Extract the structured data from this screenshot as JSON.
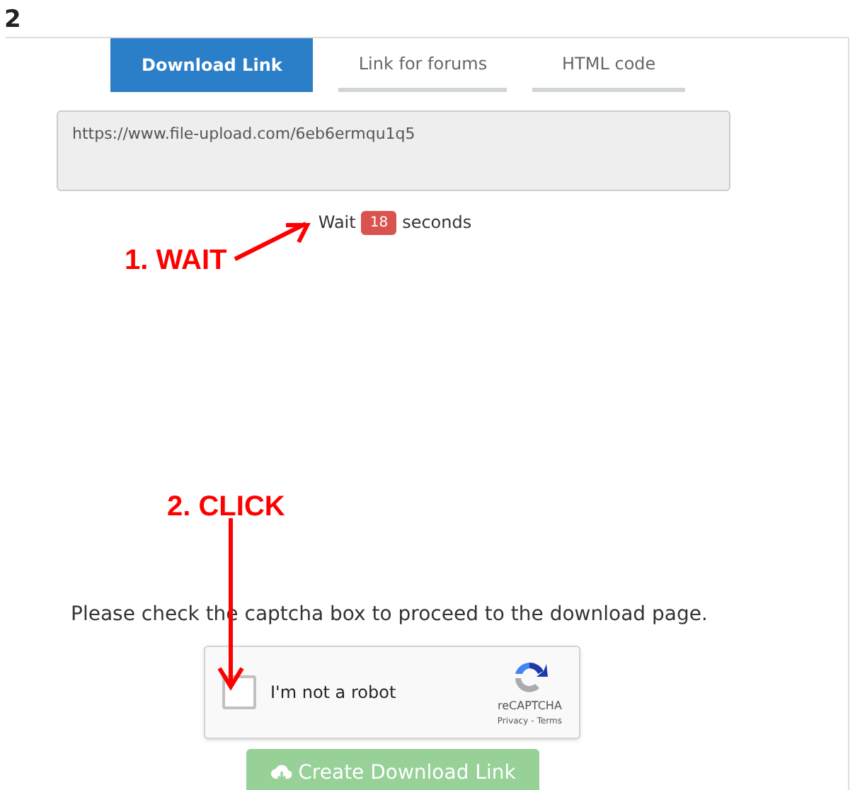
{
  "step_number": "2",
  "tabs": [
    {
      "label": "Download Link",
      "selected": true
    },
    {
      "label": "Link for forums",
      "selected": false
    },
    {
      "label": "HTML code",
      "selected": false
    }
  ],
  "link_field": {
    "value": "https://www.file-upload.com/6eb6ermqu1q5"
  },
  "countdown": {
    "prefix": "Wait",
    "count": "18",
    "suffix": "seconds"
  },
  "annotations": [
    {
      "text": "1. WAIT"
    },
    {
      "text": "2. CLICK"
    }
  ],
  "instruction": "Please check the captcha box to proceed to the download page.",
  "captcha": {
    "label": "I'm not a robot",
    "checked": false,
    "brand": "reCAPTCHA",
    "privacy": "Privacy",
    "separator": "-",
    "terms": "Terms"
  },
  "create_button": {
    "label": "Create Download Link",
    "disabled": true
  }
}
